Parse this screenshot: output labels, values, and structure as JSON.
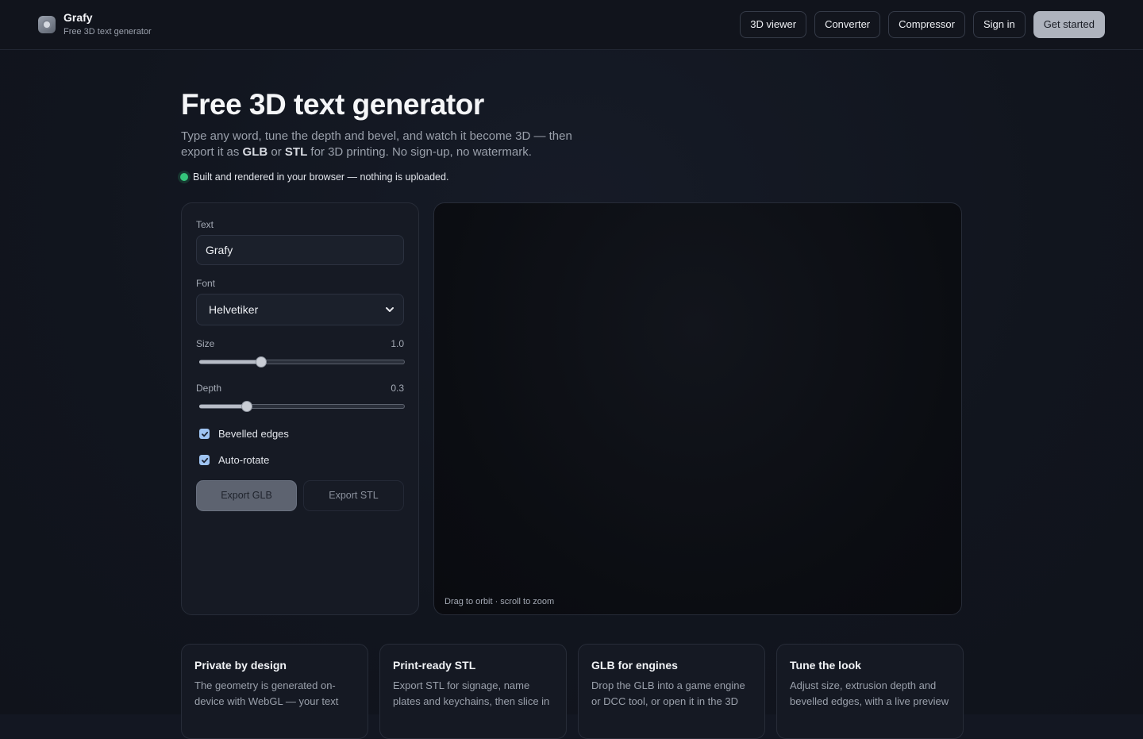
{
  "header": {
    "brand_name": "Grafy",
    "brand_tagline": "Free 3D text generator",
    "nav": [
      {
        "label": "3D viewer"
      },
      {
        "label": "Converter"
      },
      {
        "label": "Compressor"
      },
      {
        "label": "Sign in"
      },
      {
        "label": "Get started"
      }
    ]
  },
  "hero": {
    "title": "Free 3D text generator",
    "desc_part1": "Type any word, tune the depth and bevel, and watch it become 3D — then export it as ",
    "desc_glb": "GLB",
    "desc_or": " or ",
    "desc_stl": "STL",
    "desc_part2": " for 3D printing. No sign-up, no watermark.",
    "note": "Built and rendered in your browser — nothing is uploaded."
  },
  "controls": {
    "text_label": "Text",
    "text_value": "Grafy",
    "font_label": "Font",
    "font_value": "Helvetiker",
    "size_label": "Size",
    "size_value": "1.0",
    "size_fraction": 0.3,
    "depth_label": "Depth",
    "depth_value": "0.3",
    "depth_fraction": 0.23,
    "bevel_label": "Bevelled edges",
    "bevel_checked": true,
    "autorotate_label": "Auto-rotate",
    "autorotate_checked": true,
    "export_glb": "Export GLB",
    "export_stl": "Export STL"
  },
  "viewer": {
    "hint": "Drag to orbit · scroll to zoom"
  },
  "features": [
    {
      "title": "Private by design",
      "desc": "The geometry is generated on-device with WebGL — your text"
    },
    {
      "title": "Print-ready STL",
      "desc": "Export STL for signage, name plates and keychains, then slice in"
    },
    {
      "title": "GLB for engines",
      "desc": "Drop the GLB into a game engine or DCC tool, or open it in the 3D"
    },
    {
      "title": "Tune the look",
      "desc": "Adjust size, extrusion depth and bevelled edges, with a live preview"
    }
  ],
  "colors": {
    "accent_green": "#34c77b",
    "checkbox": "#9fc4f2",
    "primary_button": "#aeb3bd"
  }
}
